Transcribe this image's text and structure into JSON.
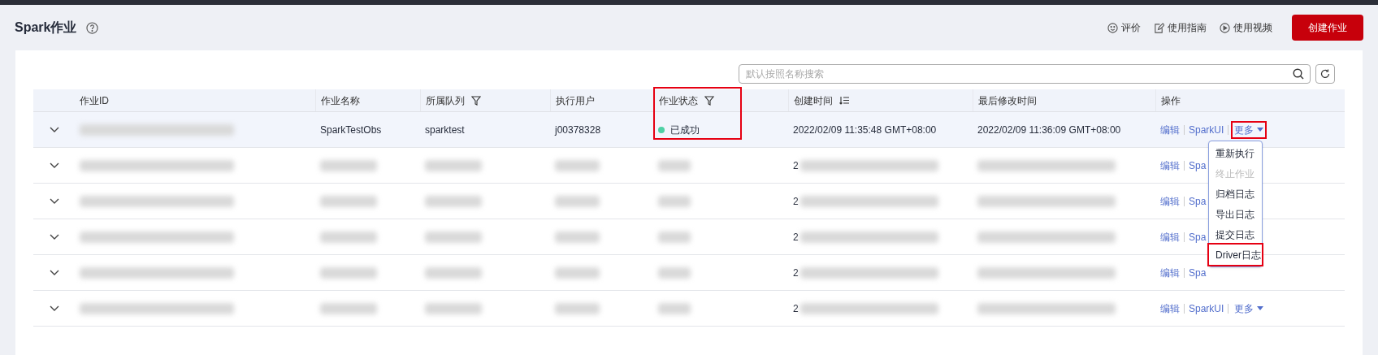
{
  "page": {
    "title": "Spark作业",
    "header_links": [
      {
        "label": "评价",
        "kind": "smile"
      },
      {
        "label": "使用指南",
        "kind": "guide"
      },
      {
        "label": "使用视频",
        "kind": "video"
      }
    ],
    "create_button": "创建作业"
  },
  "search": {
    "placeholder": "默认按照名称搜索"
  },
  "table": {
    "columns": [
      {
        "label": "作业ID",
        "filterable": false,
        "sortable": false,
        "highlighted": false
      },
      {
        "label": "作业名称",
        "filterable": false,
        "sortable": false,
        "highlighted": false
      },
      {
        "label": "所属队列",
        "filterable": true,
        "sortable": false,
        "highlighted": false
      },
      {
        "label": "执行用户",
        "filterable": false,
        "sortable": false,
        "highlighted": false
      },
      {
        "label": "作业状态",
        "filterable": true,
        "sortable": false,
        "highlighted": true
      },
      {
        "label": "创建时间",
        "filterable": false,
        "sortable": true,
        "highlighted": false
      },
      {
        "label": "最后修改时间",
        "filterable": false,
        "sortable": false,
        "highlighted": false
      },
      {
        "label": "操作",
        "filterable": false,
        "sortable": false,
        "highlighted": false
      }
    ],
    "rows": [
      {
        "blurred": false,
        "selected": true,
        "name": "SparkTestObs",
        "queue": "sparktest",
        "user": "j00378328",
        "status": {
          "label": "已成功",
          "color": "#4fd1a5"
        },
        "created": "2022/02/09 11:35:48 GMT+08:00",
        "modified": "2022/02/09 11:36:09 GMT+08:00",
        "actions": [
          "编辑",
          "SparkUI"
        ],
        "more": {
          "label": "更多",
          "highlighted": true
        }
      },
      {
        "blurred": true,
        "selected": false,
        "created": "2",
        "actions": [
          "编辑",
          "Spa"
        ]
      },
      {
        "blurred": true,
        "selected": false,
        "created": "2",
        "actions": [
          "编辑",
          "Spa"
        ]
      },
      {
        "blurred": true,
        "selected": false,
        "created": "2",
        "actions": [
          "编辑",
          "Spa"
        ]
      },
      {
        "blurred": true,
        "selected": false,
        "created": "2",
        "actions": [
          "编辑",
          "Spa"
        ]
      },
      {
        "blurred": true,
        "selected": false,
        "created": "2",
        "actions": [
          "编辑",
          "SparkUI"
        ],
        "more": {
          "label": "更多",
          "highlighted": false
        }
      }
    ]
  },
  "menu": {
    "items": [
      {
        "label": "重新执行",
        "disabled": false,
        "highlighted": false
      },
      {
        "label": "终止作业",
        "disabled": true,
        "highlighted": false
      },
      {
        "label": "归档日志",
        "disabled": false,
        "highlighted": false
      },
      {
        "label": "导出日志",
        "disabled": false,
        "highlighted": false
      },
      {
        "label": "提交日志",
        "disabled": false,
        "highlighted": false
      },
      {
        "label": "Driver日志",
        "disabled": false,
        "highlighted": true
      }
    ]
  }
}
